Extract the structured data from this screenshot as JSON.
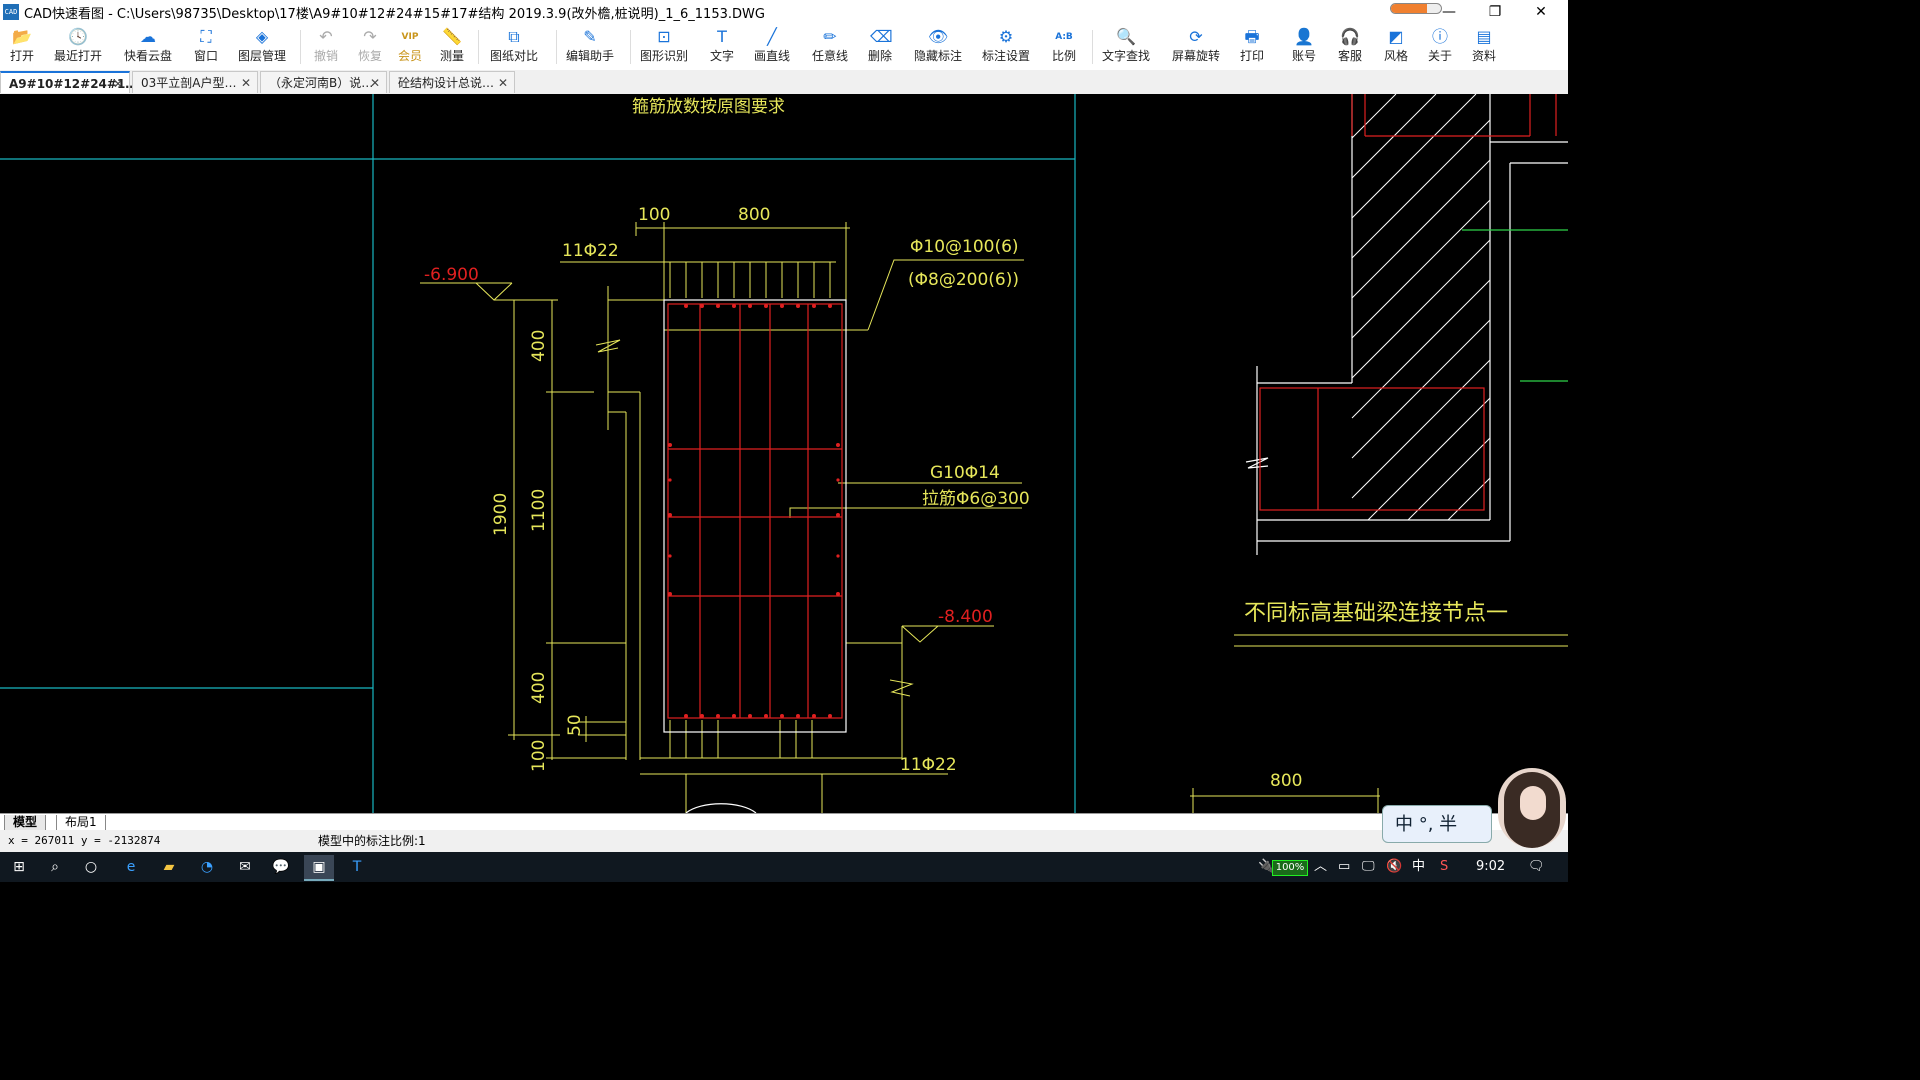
{
  "window": {
    "title": "CAD快速看图 - C:\\Users\\98735\\Desktop\\17楼\\A9#10#12#24#15#17#结构 2019.3.9(改外檐,桩说明)_1_6_1153.DWG",
    "app_icon_text": "CAD"
  },
  "toolbar": {
    "items": [
      {
        "label": "打开",
        "icon": "folder-open-icon",
        "glyph": "📂"
      },
      {
        "label": "最近打开",
        "icon": "history-icon",
        "glyph": "🕓"
      },
      {
        "label": "快看云盘",
        "icon": "cloud-icon",
        "glyph": "☁"
      },
      {
        "label": "窗口",
        "icon": "window-icon",
        "glyph": "⛶"
      },
      {
        "label": "图层管理",
        "icon": "layers-icon",
        "glyph": "◈"
      },
      {
        "label": "撤销",
        "icon": "undo-icon",
        "glyph": "↶"
      },
      {
        "label": "恢复",
        "icon": "redo-icon",
        "glyph": "↷"
      },
      {
        "label": "会员",
        "icon": "vip-icon",
        "glyph": "VIP"
      },
      {
        "label": "测量",
        "icon": "ruler-icon",
        "glyph": "📏"
      },
      {
        "label": "图纸对比",
        "icon": "compare-icon",
        "glyph": "⧉"
      },
      {
        "label": "编辑助手",
        "icon": "edit-assistant-icon",
        "glyph": "✎"
      },
      {
        "label": "图形识别",
        "icon": "shape-recognition-icon",
        "glyph": "⊡"
      },
      {
        "label": "文字",
        "icon": "text-icon",
        "glyph": "T"
      },
      {
        "label": "画直线",
        "icon": "line-icon",
        "glyph": "╱"
      },
      {
        "label": "任意线",
        "icon": "freehand-icon",
        "glyph": "✏"
      },
      {
        "label": "删除",
        "icon": "eraser-icon",
        "glyph": "⌫"
      },
      {
        "label": "隐藏标注",
        "icon": "hide-annotation-icon",
        "glyph": "👁"
      },
      {
        "label": "标注设置",
        "icon": "annotation-settings-icon",
        "glyph": "⚙"
      },
      {
        "label": "比例",
        "icon": "scale-icon",
        "glyph": "A:B"
      },
      {
        "label": "文字查找",
        "icon": "text-search-icon",
        "glyph": "🔍"
      },
      {
        "label": "屏幕旋转",
        "icon": "rotate-screen-icon",
        "glyph": "⟳"
      },
      {
        "label": "打印",
        "icon": "print-icon",
        "glyph": "🖶"
      },
      {
        "label": "账号",
        "icon": "account-icon",
        "glyph": "👤"
      },
      {
        "label": "客服",
        "icon": "headset-icon",
        "glyph": "🎧"
      },
      {
        "label": "风格",
        "icon": "style-icon",
        "glyph": "◩"
      },
      {
        "label": "关于",
        "icon": "info-icon",
        "glyph": "ⓘ"
      },
      {
        "label": "资料",
        "icon": "docs-icon",
        "glyph": "▤"
      }
    ]
  },
  "tabs": [
    {
      "label": "A9#10#12#24#1…",
      "active": true
    },
    {
      "label": "03平立剖A户型…",
      "active": false
    },
    {
      "label": "（永定河南B）说…",
      "active": false
    },
    {
      "label": "砼结构设计总说…",
      "active": false
    }
  ],
  "drawing": {
    "top_note": "箍筋放数按原图要求",
    "dim_100": "100",
    "dim_800": "800",
    "rebar_top": "11Φ22",
    "elev_top": "-6.900",
    "stirrup_1": "Φ10@100(6)",
    "stirrup_2": "(Φ8@200(6))",
    "dim_400_upper": "400",
    "dim_1900": "1900",
    "dim_1100": "1100",
    "side_rebar": "G10Φ14",
    "tie_bar": "拉筋Φ6@300",
    "elev_bottom": "-8.400",
    "dim_400_lower": "400",
    "dim_50": "50",
    "dim_100_bottom": "100",
    "rebar_bottom": "11Φ22",
    "node_title": "不同标高基础梁连接节点一",
    "dim_800_right": "800"
  },
  "layout_tabs": [
    "模型",
    "布局1"
  ],
  "status": {
    "coords": "x = 267011  y = -2132874",
    "scale_text": "模型中的标注比例:1"
  },
  "ime": {
    "text": "中 °, 半"
  },
  "taskbar": {
    "battery": "100%",
    "ime_lang": "中",
    "clock": "9:02"
  }
}
